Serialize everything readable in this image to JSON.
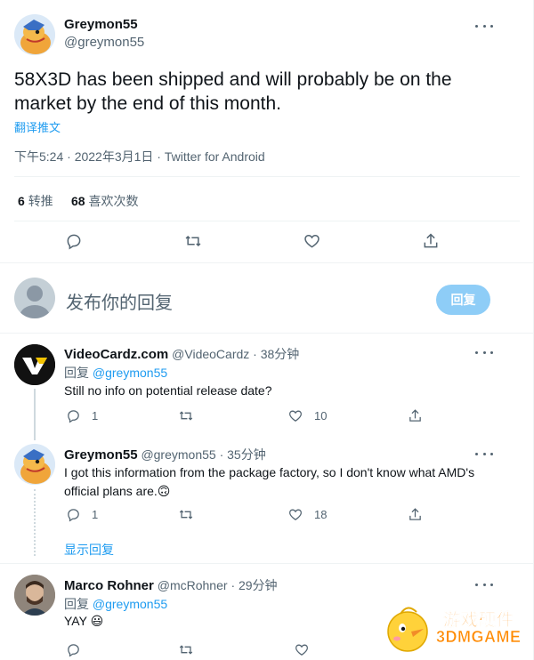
{
  "main_tweet": {
    "display_name": "Greymon55",
    "handle": "@greymon55",
    "text": "58X3D has been shipped and will probably be on the market by the end of this month.",
    "translate_label": "翻译推文",
    "meta": "下午5:24 · 2022年3月1日 · Twitter for Android",
    "retweets_count": "6",
    "retweets_label": "转推",
    "likes_count": "68",
    "likes_label": "喜欢次数"
  },
  "compose": {
    "placeholder": "发布你的回复",
    "reply_button": "回复"
  },
  "replies": [
    {
      "display_name": "VideoCardz.com",
      "handle": "@VideoCardz",
      "time": "· 38分钟",
      "reply_to_prefix": "回复",
      "reply_to_handle": "@greymon55",
      "text": "Still no info on potential release date?",
      "reply_count": "1",
      "like_count": "10"
    },
    {
      "display_name": "Greymon55",
      "handle": "@greymon55",
      "time": "· 35分钟",
      "text": "I got this information from the package factory, so I don't know what AMD's official plans are.🙃",
      "reply_count": "1",
      "like_count": "18"
    },
    {
      "display_name": "Marco Rohner",
      "handle": "@mcRohner",
      "time": "· 29分钟",
      "reply_to_prefix": "回复",
      "reply_to_handle": "@greymon55",
      "text": "YAY 😃"
    }
  ],
  "show_replies_label": "显示回复",
  "watermark": {
    "line1": "游戏硬件",
    "line2": "3DMGAME"
  },
  "colors": {
    "accent": "#1d9bf0",
    "reply_button_bg": "#8ecdf7",
    "muted_text": "#536471",
    "divider": "#eff3f4"
  }
}
